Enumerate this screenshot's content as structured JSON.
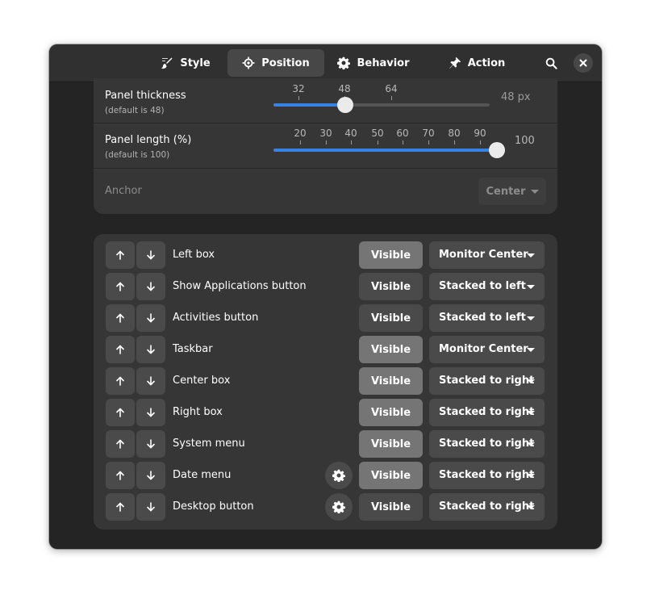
{
  "tabs": [
    {
      "label": "Style",
      "icon": "style-brush-icon",
      "active": false
    },
    {
      "label": "Position",
      "icon": "position-crosshair-icon",
      "active": true
    },
    {
      "label": "Behavior",
      "icon": "gear-icon",
      "active": false
    },
    {
      "label": "Action",
      "icon": "pin-icon",
      "active": false
    }
  ],
  "header": {
    "search_icon": "search-icon",
    "close_icon": "close-icon"
  },
  "thickness": {
    "title": "Panel thickness",
    "subtitle": "(default is 48)",
    "marks": [
      "32",
      "48",
      "64"
    ],
    "value_label": "48 px",
    "value": 48
  },
  "length": {
    "title": "Panel length (%)",
    "subtitle": "(default is 100)",
    "marks": [
      "20",
      "30",
      "40",
      "50",
      "60",
      "70",
      "80",
      "90"
    ],
    "end_mark": "100",
    "value": 100
  },
  "anchor": {
    "label": "Anchor",
    "value": "Center"
  },
  "items": [
    {
      "label": "Left box",
      "visible": "Visible",
      "visible_on": true,
      "position": "Monitor Center",
      "gear": false
    },
    {
      "label": "Show Applications button",
      "visible": "Visible",
      "visible_on": false,
      "position": "Stacked to left",
      "gear": false
    },
    {
      "label": "Activities button",
      "visible": "Visible",
      "visible_on": false,
      "position": "Stacked to left",
      "gear": false
    },
    {
      "label": "Taskbar",
      "visible": "Visible",
      "visible_on": true,
      "position": "Monitor Center",
      "gear": false
    },
    {
      "label": "Center box",
      "visible": "Visible",
      "visible_on": true,
      "position": "Stacked to right",
      "gear": false
    },
    {
      "label": "Right box",
      "visible": "Visible",
      "visible_on": true,
      "position": "Stacked to right",
      "gear": false
    },
    {
      "label": "System menu",
      "visible": "Visible",
      "visible_on": true,
      "position": "Stacked to right",
      "gear": false
    },
    {
      "label": "Date menu",
      "visible": "Visible",
      "visible_on": true,
      "position": "Stacked to right",
      "gear": true
    },
    {
      "label": "Desktop button",
      "visible": "Visible",
      "visible_on": false,
      "position": "Stacked to right",
      "gear": true
    }
  ],
  "colors": {
    "accent": "#3584e4",
    "window_bg": "#242424",
    "card_bg": "#363636"
  }
}
